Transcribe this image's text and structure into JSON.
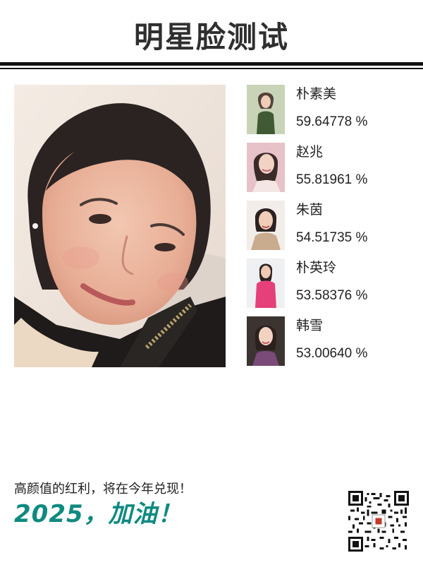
{
  "header": {
    "title": "明星脸测试"
  },
  "matches": [
    {
      "name": "朴素美",
      "score": "59.64778 %"
    },
    {
      "name": "赵兆",
      "score": "55.81961 %"
    },
    {
      "name": "朱茵",
      "score": "54.51735 %"
    },
    {
      "name": "朴英玲",
      "score": "53.58376 %"
    },
    {
      "name": "韩雪",
      "score": "53.00640 %"
    }
  ],
  "footer": {
    "slogan": "高颜值的红利，将在今年兑现！",
    "cheer": "2025，加油！"
  },
  "colors": {
    "accent": "#0f8a80",
    "rule": "#111111",
    "text": "#222222"
  },
  "icons": {
    "qr": "qr-code-icon"
  }
}
